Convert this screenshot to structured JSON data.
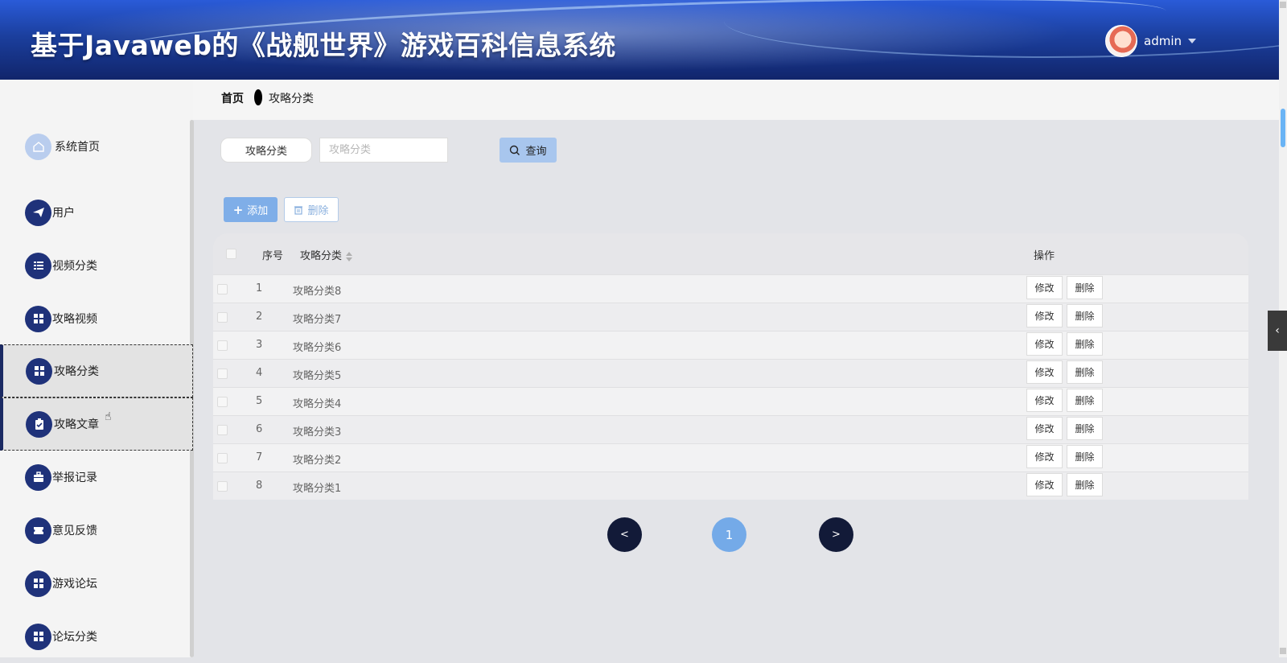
{
  "header": {
    "title": "基于Javaweb的《战舰世界》游戏百科信息系统",
    "username": "admin"
  },
  "breadcrumb": {
    "home": "首页",
    "current": "攻略分类"
  },
  "sidebar": {
    "items": [
      {
        "label": "系统首页",
        "icon": "home-icon"
      },
      {
        "label": "用户",
        "icon": "paper-plane-icon"
      },
      {
        "label": "视频分类",
        "icon": "list-icon"
      },
      {
        "label": "攻略视频",
        "icon": "grid-icon"
      },
      {
        "label": "攻略分类",
        "icon": "grid-icon",
        "active": true
      },
      {
        "label": "攻略文章",
        "icon": "clipboard-icon"
      },
      {
        "label": "举报记录",
        "icon": "briefcase-icon"
      },
      {
        "label": "意见反馈",
        "icon": "ticket-icon"
      },
      {
        "label": "游戏论坛",
        "icon": "grid-icon"
      },
      {
        "label": "论坛分类",
        "icon": "grid-icon"
      }
    ]
  },
  "search": {
    "field_label": "攻略分类",
    "placeholder": "攻略分类",
    "button_label": "查询"
  },
  "actions": {
    "add_label": "添加",
    "delete_label": "删除"
  },
  "table": {
    "columns": {
      "index": "序号",
      "category": "攻略分类",
      "operation": "操作"
    },
    "rows": [
      {
        "index": "1",
        "category": "攻略分类8",
        "edit": "修改",
        "delete": "删除"
      },
      {
        "index": "2",
        "category": "攻略分类7",
        "edit": "修改",
        "delete": "删除"
      },
      {
        "index": "3",
        "category": "攻略分类6",
        "edit": "修改",
        "delete": "删除"
      },
      {
        "index": "4",
        "category": "攻略分类5",
        "edit": "修改",
        "delete": "删除"
      },
      {
        "index": "5",
        "category": "攻略分类4",
        "edit": "修改",
        "delete": "删除"
      },
      {
        "index": "6",
        "category": "攻略分类3",
        "edit": "修改",
        "delete": "删除"
      },
      {
        "index": "7",
        "category": "攻略分类2",
        "edit": "修改",
        "delete": "删除"
      },
      {
        "index": "8",
        "category": "攻略分类1",
        "edit": "修改",
        "delete": "删除"
      }
    ]
  },
  "pagination": {
    "prev": "<",
    "current_page": "1",
    "next": ">"
  },
  "colors": {
    "header_dark": "#11256b",
    "nav_icon": "#1f327a",
    "primary_button": "#7faee8",
    "pager_dark": "#121a38",
    "pager_current": "#74aae8"
  }
}
